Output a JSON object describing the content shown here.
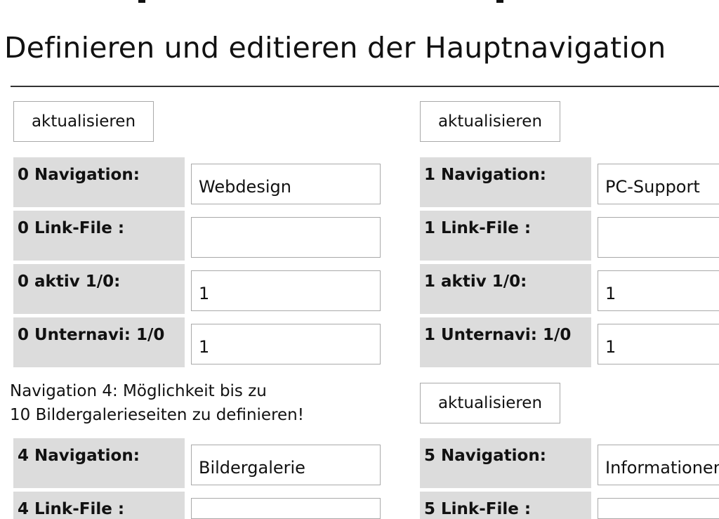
{
  "page": {
    "title": "Definieren und editieren der Hauptnavigation"
  },
  "sections": {
    "s0": {
      "update_label": "aktualisieren",
      "nav_label": "0 Navigation:",
      "nav_value": "Webdesign",
      "link_label": "0 Link-File :",
      "link_value": "",
      "aktiv_label": "0 aktiv 1/0:",
      "aktiv_value": "1",
      "unternavi_label": "0 Unternavi: 1/0",
      "unternavi_value": "1"
    },
    "s1": {
      "update_label": "aktualisieren",
      "nav_label": "1 Navigation:",
      "nav_value": "PC-Support",
      "link_label": "1 Link-File :",
      "link_value": "",
      "aktiv_label": "1 aktiv 1/0:",
      "aktiv_value": "1",
      "unternavi_label": "1 Unternavi: 1/0",
      "unternavi_value": "1"
    },
    "s4": {
      "note_line1": "Navigation 4: Möglichkeit bis zu",
      "note_line2": "10 Bildergalerieseiten zu definieren!",
      "nav_label": "4 Navigation:",
      "nav_value": "Bildergalerie",
      "link_label": "4 Link-File :",
      "link_value": ""
    },
    "s5": {
      "update_label": "aktualisieren",
      "nav_label": "5 Navigation:",
      "nav_value": "Informationen",
      "link_label": "5 Link-File :",
      "link_value": ""
    }
  }
}
